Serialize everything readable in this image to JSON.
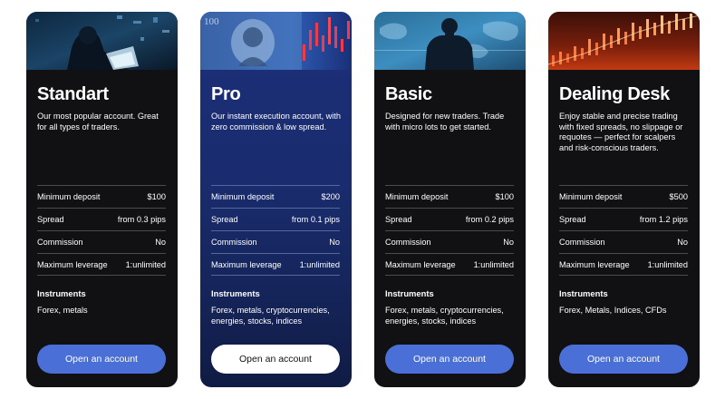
{
  "accent_color": "#4a6fd6",
  "cards": [
    {
      "image": "person-at-laptop-image",
      "title": "Standart",
      "description": "Our most popular account. Great for all types of traders.",
      "specs": [
        {
          "label": "Minimum deposit",
          "value": "$100"
        },
        {
          "label": "Spread",
          "value": "from 0.3 pips"
        },
        {
          "label": "Commission",
          "value": "No"
        },
        {
          "label": "Maximum leverage",
          "value": "1:unlimited"
        }
      ],
      "instruments_title": "Instruments",
      "instruments": "Forex, metals",
      "button": "Open an account"
    },
    {
      "image": "dollar-bill-chart-image",
      "title": "Pro",
      "description": "Our instant execution account, with zero commission & low spread.",
      "specs": [
        {
          "label": "Minimum deposit",
          "value": "$200"
        },
        {
          "label": "Spread",
          "value": "from 0.1 pips"
        },
        {
          "label": "Commission",
          "value": "No"
        },
        {
          "label": "Maximum leverage",
          "value": "1:unlimited"
        }
      ],
      "instruments_title": "Instruments",
      "instruments": "Forex, metals, cryptocurrencies, energies, stocks, indices",
      "button": "Open an account"
    },
    {
      "image": "trader-at-world-map-image",
      "title": "Basic",
      "description": "Designed for new traders. Trade with micro lots to get started.",
      "specs": [
        {
          "label": "Minimum deposit",
          "value": "$100"
        },
        {
          "label": "Spread",
          "value": "from 0.2 pips"
        },
        {
          "label": "Commission",
          "value": "No"
        },
        {
          "label": "Maximum leverage",
          "value": "1:unlimited"
        }
      ],
      "instruments_title": "Instruments",
      "instruments": "Forex, metals, cryptocurrencies, energies, stocks, indices",
      "button": "Open an account"
    },
    {
      "image": "candlestick-chart-image",
      "title": "Dealing Desk",
      "description": "Enjoy stable and precise trading with fixed spreads, no slippage or requotes — perfect for scalpers and risk-conscious traders.",
      "specs": [
        {
          "label": "Minimum deposit",
          "value": "$500"
        },
        {
          "label": "Spread",
          "value": "from 1.2 pips"
        },
        {
          "label": "Commission",
          "value": "No"
        },
        {
          "label": "Maximum leverage",
          "value": "1:unlimited"
        }
      ],
      "instruments_title": "Instruments",
      "instruments": "Forex, Metals, Indices, CFDs",
      "button": "Open an account"
    }
  ]
}
